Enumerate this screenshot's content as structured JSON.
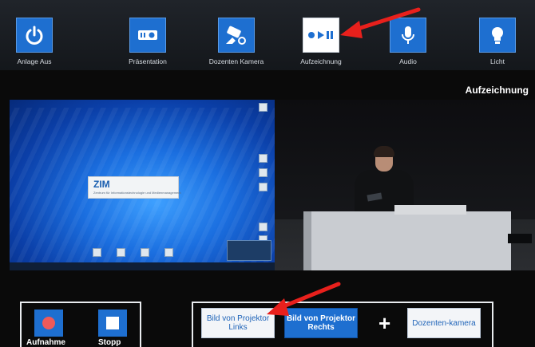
{
  "toolbar": {
    "items": [
      {
        "label": "Anlage Aus",
        "icon": "power-icon"
      },
      {
        "label": "Präsentation",
        "icon": "projector-icon"
      },
      {
        "label": "Dozenten Kamera",
        "icon": "camera-icon"
      },
      {
        "label": "Aufzeichnung",
        "icon": "record-play-pause-icon",
        "active": true
      },
      {
        "label": "Audio",
        "icon": "microphone-icon"
      },
      {
        "label": "Licht",
        "icon": "lightbulb-icon"
      }
    ]
  },
  "section_title": "Aufzeichnung",
  "preview": {
    "desktop_logo": "ZIM",
    "desktop_logo_sub": "Zentrum für Informationstechnologie und Medienmanagement"
  },
  "recording": {
    "record_label": "Aufnahme",
    "stop_label": "Stopp"
  },
  "sources": {
    "left": "Bild von Projektor Links",
    "right": "Bild von Projektor Rechts",
    "plus": "+",
    "camera": "Dozenten-kamera"
  },
  "colors": {
    "accent": "#1e6fd0",
    "record_dot": "#f05a5a",
    "annotation": "#e8201c"
  }
}
